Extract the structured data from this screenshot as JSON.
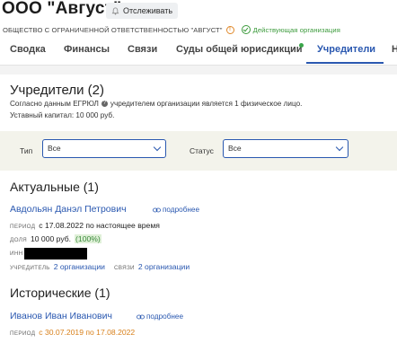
{
  "header": {
    "company_name": "ООО \"Август\"",
    "follow_label": "Отслеживать",
    "full_name": "ОБЩЕСТВО С ОГРАНИЧЕННОЙ ОТВЕТСТВЕННОСТЬЮ \"АВГУСТ\"",
    "status": "Действующая организация"
  },
  "tabs": [
    "Сводка",
    "Финансы",
    "Связи",
    "Суды общей юрисдикции",
    "Учредители",
    "Н"
  ],
  "active_tab": "Учредители",
  "founders": {
    "heading": "Учредители (2)",
    "description_prefix": "Согласно данным ЕГРЮЛ",
    "description_suffix": "учредителем организации является 1 физическое лицо.",
    "capital": "Уставный капитал: 10 000 руб."
  },
  "filters": {
    "type_label": "Тип",
    "type_value": "Все",
    "status_label": "Статус",
    "status_value": "Все"
  },
  "current": {
    "heading": "Актуальные (1)",
    "person": {
      "name": "Авдольян Данэл Петрович",
      "more": "подробнее",
      "period_label": "период",
      "period_value": "с 17.08.2022 по настоящее время",
      "share_label": "доля",
      "share_value": "10 000 руб.",
      "share_pct": "(100%)",
      "inn_label": "инн",
      "founder_label": "учредитель",
      "founder_value": "2 организации",
      "links_label": "связи",
      "links_value": "2 организации"
    }
  },
  "historical": {
    "heading": "Исторические (1)",
    "person": {
      "name": "Иванов Иван Иванович",
      "more": "подробнее",
      "period_label": "период",
      "period_value": "с 30.07.2019 по 17.08.2022"
    }
  },
  "colors": {
    "accent": "#2a58b0",
    "status_green": "#3b9a3b",
    "period_orange": "#d8801b",
    "filter_bg": "#f3f3eb"
  }
}
